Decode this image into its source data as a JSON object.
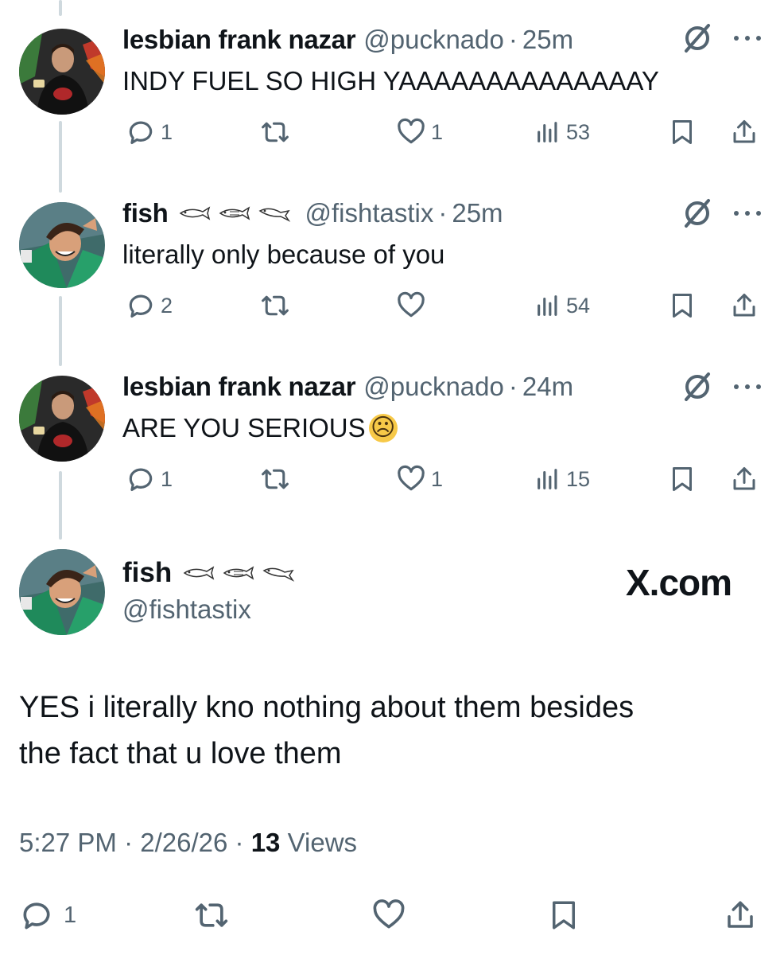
{
  "tweets": [
    {
      "name": "lesbian frank nazar",
      "handle": "@pucknado",
      "separator": "·",
      "time": "25m",
      "text": "INDY FUEL SO HIGH YAAAAAAAAAAAAAAY",
      "emoji": "",
      "replies": "1",
      "retweets": "",
      "likes": "1",
      "views": "53"
    },
    {
      "name": "fish",
      "handle": "@fishtastix",
      "separator": "·",
      "time": "25m",
      "text": "literally only because of you",
      "emoji": "",
      "replies": "2",
      "retweets": "",
      "likes": "",
      "views": "54"
    },
    {
      "name": "lesbian frank nazar",
      "handle": "@pucknado",
      "separator": "·",
      "time": "24m",
      "text": "ARE YOU SERIOUS",
      "emoji": "☹",
      "replies": "1",
      "retweets": "",
      "likes": "1",
      "views": "15"
    }
  ],
  "main_tweet": {
    "name": "fish",
    "handle": "@fishtastix",
    "brand": "X.com",
    "text_line1": "YES i literally kno nothing about them besides",
    "text_line2": "the fact that u love them",
    "time": "5:27 PM",
    "separator": "·",
    "date": "2/26/26",
    "views_count": "13",
    "views_label": "Views",
    "replies": "1"
  },
  "icons": {
    "reply": "reply-icon",
    "retweet": "retweet-icon",
    "like": "heart-icon",
    "views": "views-chart-icon",
    "bookmark": "bookmark-icon",
    "share": "share-icon",
    "grok": "grok-icon",
    "more": "more-icon"
  },
  "colors": {
    "text": "#0f1419",
    "secondary": "#536471",
    "thread_line": "#cfd9de"
  }
}
